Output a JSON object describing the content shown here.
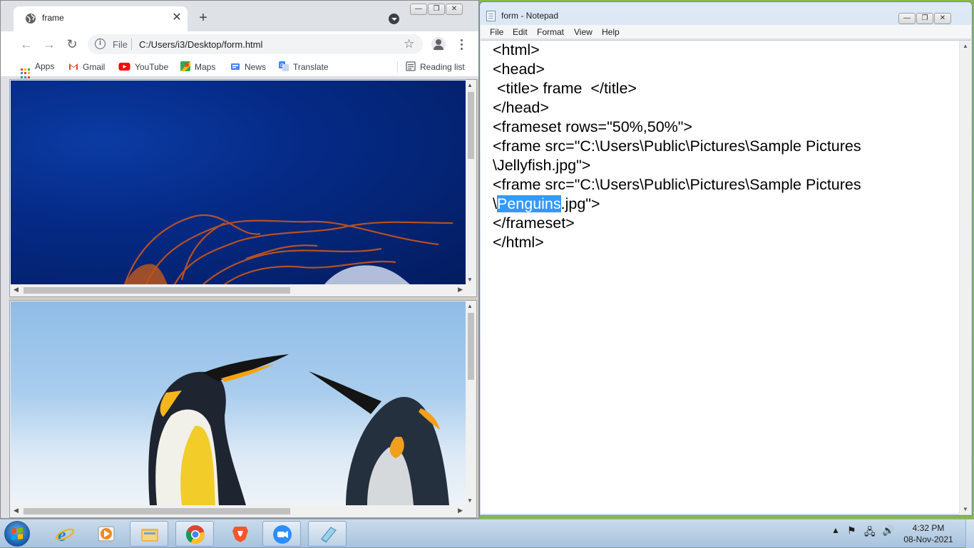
{
  "chrome": {
    "tab_title": "frame",
    "url_scheme": "File",
    "url": "C:/Users/i3/Desktop/form.html",
    "bookmarks": [
      {
        "label": "Apps",
        "icon": "apps-grid-icon"
      },
      {
        "label": "Gmail",
        "icon": "gmail-icon"
      },
      {
        "label": "YouTube",
        "icon": "youtube-icon"
      },
      {
        "label": "Maps",
        "icon": "maps-icon"
      },
      {
        "label": "News",
        "icon": "news-icon"
      },
      {
        "label": "Translate",
        "icon": "translate-icon"
      }
    ],
    "reading_list": "Reading list",
    "frames": [
      {
        "image": "Jellyfish.jpg"
      },
      {
        "image": "Penguins.jpg"
      }
    ]
  },
  "notepad": {
    "title": "form - Notepad",
    "menu": [
      "File",
      "Edit",
      "Format",
      "View",
      "Help"
    ],
    "lines": [
      "<html>",
      "<head>",
      " <title> frame  </title>",
      "</head>",
      "<frameset rows=\"50%,50%\">",
      "<frame src=\"C:\\Users\\Public\\Pictures\\Sample Pictures",
      "\\Jellyfish.jpg\">",
      "<frame src=\"C:\\Users\\Public\\Pictures\\Sample Pictures",
      "\\",
      "Penguins",
      ".jpg\">",
      "</frameset>",
      "</html>"
    ]
  },
  "taskbar": {
    "time": "4:32 PM",
    "date": "08-Nov-2021",
    "apps": [
      "internet-explorer-icon",
      "media-player-icon",
      "file-explorer-icon",
      "chrome-icon",
      "brave-icon",
      "zoom-icon",
      "notepad-icon"
    ]
  },
  "colors": {
    "selection": "#3399ff",
    "chrome_frame": "#dee1e6",
    "taskbar": "#b9d0e6"
  }
}
